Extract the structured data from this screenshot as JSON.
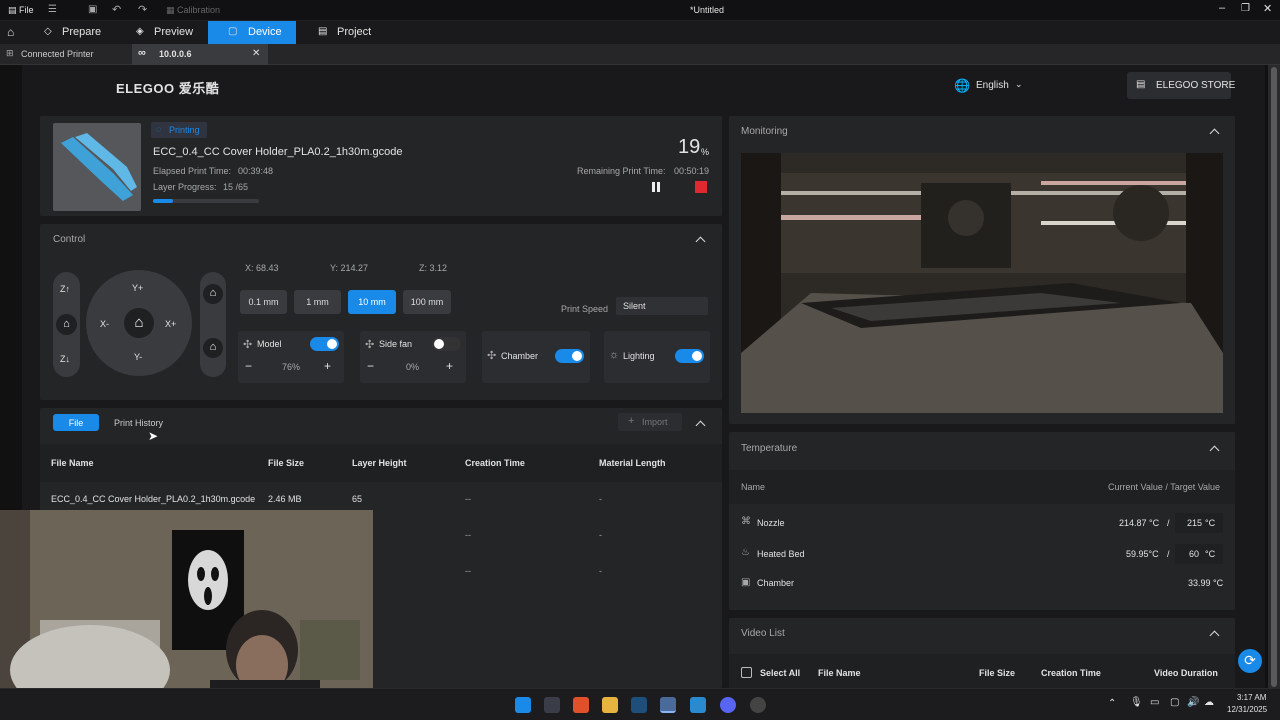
{
  "titlebar": {
    "file": "File",
    "calibration": "Calibration",
    "title": "*Untitled"
  },
  "menu": {
    "prepare": "Prepare",
    "preview": "Preview",
    "device": "Device",
    "project": "Project"
  },
  "tabs": {
    "connected_printer": "Connected Printer",
    "ip": "10.0.0.6"
  },
  "header": {
    "logo": "ELEGOO 爱乐酷",
    "language": "English",
    "store": "ELEGOO STORE"
  },
  "job": {
    "status": "Printing",
    "filename": "ECC_0.4_CC Cover Holder_PLA0.2_1h30m.gcode",
    "elapsed_label": "Elapsed Print Time:",
    "elapsed": "00:39:48",
    "layer_label": "Layer Progress:",
    "layer": "15 /65",
    "percent": "19",
    "percent_unit": "%",
    "progress": 0.19,
    "remaining_label": "Remaining Print Time:",
    "remaining": "00:50:19"
  },
  "control": {
    "title": "Control",
    "z_up": "Z↑",
    "z_down": "Z↓",
    "y_plus": "Y+",
    "y_minus": "Y-",
    "x_minus": "X-",
    "x_plus": "X+",
    "x": "X:  68.43",
    "y": "Y:  214.27",
    "z": "Z:  3.12",
    "steps": [
      "0.1 mm",
      "1 mm",
      "10 mm",
      "100 mm"
    ],
    "print_speed_label": "Print Speed",
    "print_speed": "Silent",
    "model_fan": "Model",
    "model_pct": "76%",
    "side_fan": "Side fan",
    "side_pct": "0%",
    "chamber": "Chamber",
    "lighting": "Lighting",
    "minus": "−",
    "plus": "+"
  },
  "files": {
    "tab_file": "File",
    "tab_history": "Print History",
    "import": "Import",
    "columns": [
      "File Name",
      "File Size",
      "Layer Height",
      "Creation Time",
      "Material Length"
    ],
    "rows": [
      [
        "ECC_0.4_CC Cover Holder_PLA0.2_1h30m.gcode",
        "2.46 MB",
        "65",
        "--",
        "-"
      ],
      [
        "",
        "",
        "",
        "--",
        "-"
      ],
      [
        "",
        "",
        "",
        "--",
        "-"
      ]
    ]
  },
  "monitoring": {
    "title": "Monitoring"
  },
  "temperature": {
    "title": "Temperature",
    "name_col": "Name",
    "value_col": "Current Value / Target Value",
    "nozzle": "Nozzle",
    "nozzle_cur": "214.87 °C",
    "nozzle_tgt": "215",
    "unit": "°C",
    "slash": "/",
    "bed": "Heated Bed",
    "bed_cur": "59.95°C",
    "bed_tgt": "60",
    "chamber": "Chamber",
    "chamber_cur": "33.99 °C"
  },
  "video": {
    "title": "Video List",
    "select_all": "Select All",
    "columns": [
      "File Name",
      "File Size",
      "Creation Time",
      "Video Duration"
    ]
  },
  "clock": {
    "time": "3:17 AM",
    "date": "12/31/2025"
  },
  "colors": {
    "accent": "#1a8ae8",
    "stop": "#e02830"
  }
}
